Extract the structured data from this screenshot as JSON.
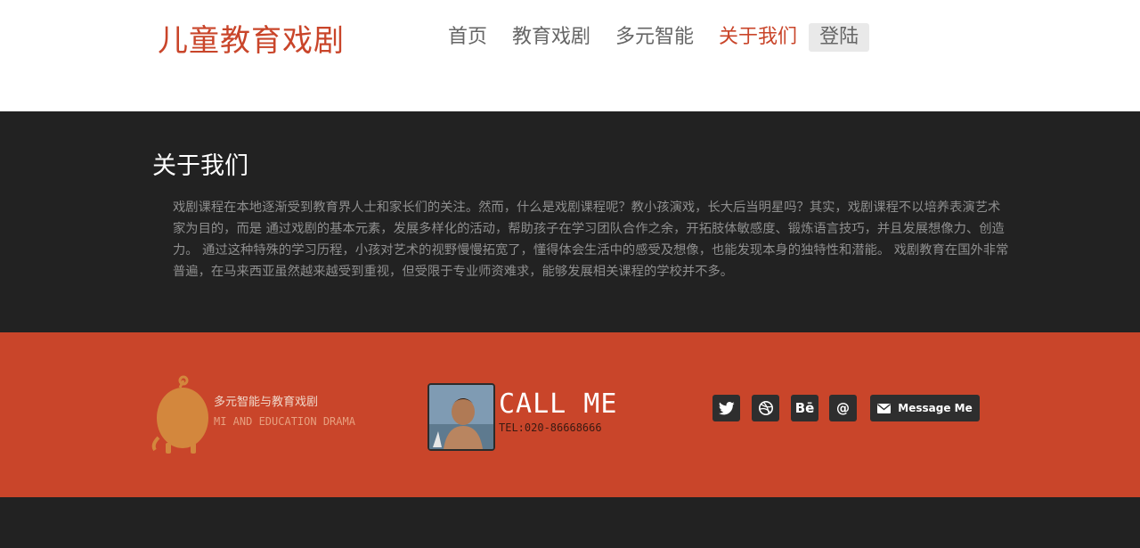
{
  "header": {
    "logo": "儿童教育戏剧",
    "nav": [
      {
        "label": "首页"
      },
      {
        "label": "教育戏剧"
      },
      {
        "label": "多元智能"
      },
      {
        "label": "关于我们"
      },
      {
        "label": "登陆"
      }
    ],
    "active_nav": "关于我们"
  },
  "about": {
    "title": "关于我们",
    "body": "戏剧课程在本地逐渐受到教育界人士和家长们的关注。然而，什么是戏剧课程呢？教小孩演戏，长大后当明星吗？其实，戏剧课程不以培养表演艺术家为目的，而是 通过戏剧的基本元素，发展多样化的活动，帮助孩子在学习团队合作之余，开拓肢体敏感度、锻炼语言技巧，并且发展想像力、创造力。 通过这种特殊的学习历程，小孩对艺术的视野慢慢拓宽了，懂得体会生活中的感受及想像，也能发现本身的独特性和潜能。 戏剧教育在国外非常普遍，在马来西亚虽然越来越受到重视，但受限于专业师资难求，能够发展相关课程的学校并不多。"
  },
  "footer": {
    "brand_cn": "多元智能与教育戏剧",
    "brand_en": "MI AND EDUCATION DRAMA",
    "call_title": "CALL ME",
    "call_tel": "TEL:020-86668666",
    "social": [
      {
        "icon": "twitter-icon"
      },
      {
        "icon": "dribbble-icon"
      },
      {
        "icon": "behance-icon",
        "glyph": "Bē"
      },
      {
        "icon": "email-at-icon",
        "glyph": "@"
      }
    ],
    "message_button": "Message Me"
  },
  "colors": {
    "accent": "#c9452a",
    "dark": "#222222",
    "nav_text": "#666666"
  }
}
